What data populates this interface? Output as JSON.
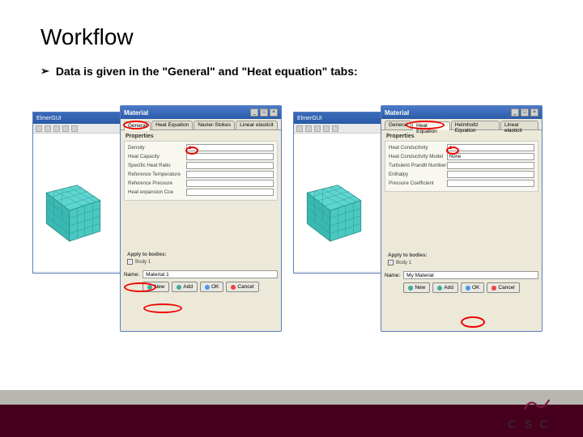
{
  "title": "Workflow",
  "bullet": "Data is given in the \"General\" and \"Heat equation\" tabs:",
  "app_title": "ElmerGUI",
  "left": {
    "dialog_title": "Material",
    "tabs": [
      "General",
      "Heat Equation",
      "Navier-Stokes",
      "Linear elasticit"
    ],
    "active_tab": 0,
    "props_header": "Properties",
    "fields": [
      {
        "label": "Density",
        "value": "1"
      },
      {
        "label": "Heat Capacity",
        "value": ""
      },
      {
        "label": "Specific Heat Ratio",
        "value": ""
      },
      {
        "label": "Reference Temperature",
        "value": ""
      },
      {
        "label": "Reference Pressure",
        "value": ""
      },
      {
        "label": "Heat expansion Coe",
        "value": ""
      }
    ],
    "apply_header": "Apply to bodies:",
    "apply_item": "Body 1",
    "name_label": "Name:",
    "name_value": "Material 1"
  },
  "right": {
    "dialog_title": "Material",
    "tabs": [
      "General",
      "Heat Equation",
      "Helmholtz Equation",
      "Linear elasticit"
    ],
    "active_tab": 1,
    "props_header": "Properties",
    "fields": [
      {
        "label": "Heat Conductivity",
        "value": "1"
      },
      {
        "label": "Heat Conductivity Model",
        "value": "None"
      },
      {
        "label": "Turbulent Prandtl Number",
        "value": ""
      },
      {
        "label": "Enthalpy",
        "value": ""
      },
      {
        "label": "Pressure Coefficient",
        "value": ""
      }
    ],
    "apply_header": "Apply to bodies:",
    "apply_item": "Body 1",
    "name_label": "Name:",
    "name_value": "My Material"
  },
  "buttons": {
    "new": "New",
    "add": "Add",
    "ok": "OK",
    "cancel": "Cancel"
  },
  "logo_text": "C S C"
}
